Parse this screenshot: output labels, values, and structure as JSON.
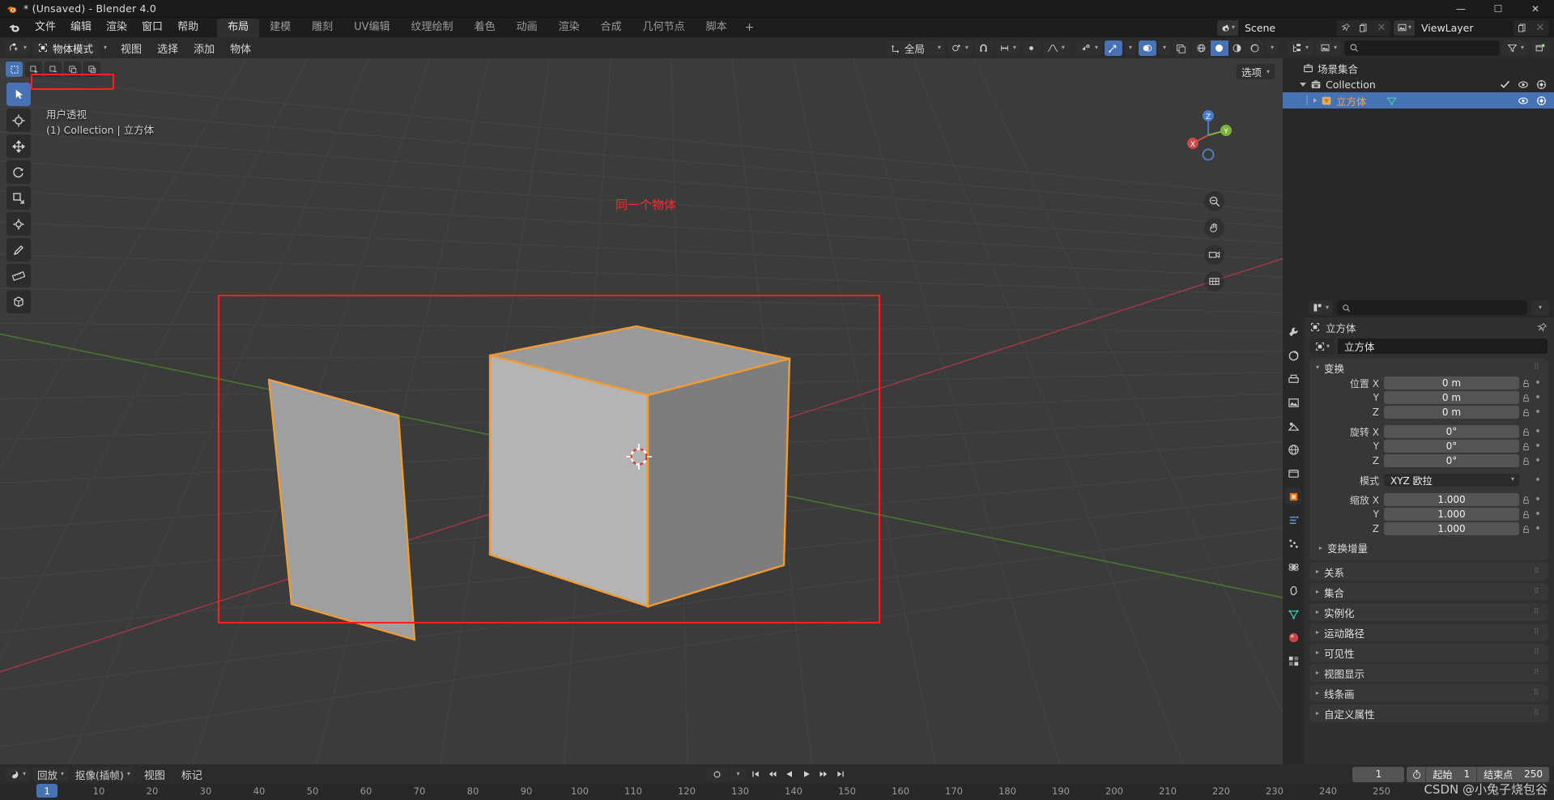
{
  "window": {
    "title": "* (Unsaved) - Blender 4.0",
    "buttons": {
      "minimize": "—",
      "maximize": "☐",
      "close": "✕"
    }
  },
  "topbar": {
    "menus": [
      "文件",
      "编辑",
      "渲染",
      "窗口",
      "帮助"
    ],
    "workspace_tabs": [
      "布局",
      "建模",
      "雕刻",
      "UV编辑",
      "纹理绘制",
      "着色",
      "动画",
      "渲染",
      "合成",
      "几何节点",
      "脚本"
    ],
    "active_workspace": "布局",
    "add_tab": "+",
    "scene_name": "Scene",
    "viewlayer_name": "ViewLayer"
  },
  "viewport": {
    "mode": "物体模式",
    "menus": [
      "视图",
      "选择",
      "添加",
      "物体"
    ],
    "transform_orientation": "全局",
    "options_label": "选项",
    "overlay_line1": "用户透视",
    "overlay_line2": "(1) Collection | 立方体",
    "annotation": "同一个物体",
    "gizmo_axes": {
      "x": "X",
      "y": "Y",
      "z": "Z"
    },
    "highlight_color": "#ff2020",
    "select_color": "#ff8c1a"
  },
  "outliner": {
    "search_placeholder": "",
    "rows": [
      {
        "label": "场景集合",
        "indent": 0,
        "selected": false,
        "has_toggle": false
      },
      {
        "label": "Collection",
        "indent": 1,
        "selected": false,
        "has_toggle": true
      },
      {
        "label": "立方体",
        "indent": 2,
        "selected": true,
        "has_toggle": true
      }
    ]
  },
  "properties": {
    "search_placeholder": "",
    "breadcrumb": "立方体",
    "object_name": "立方体",
    "transform": {
      "title": "变换",
      "location_label": "位置",
      "rotation_label": "旋转",
      "mode_label": "模式",
      "scale_label": "缩放",
      "axes": [
        "X",
        "Y",
        "Z"
      ],
      "location": [
        "0 m",
        "0 m",
        "0 m"
      ],
      "rotation": [
        "0°",
        "0°",
        "0°"
      ],
      "rotation_mode": "XYZ 欧拉",
      "scale": [
        "1.000",
        "1.000",
        "1.000"
      ],
      "delta_transform": "变换增量"
    },
    "panels": [
      "关系",
      "集合",
      "实例化",
      "运动路径",
      "可见性",
      "视图显示",
      "线条画",
      "自定义属性"
    ]
  },
  "timeline": {
    "editor_menus": [
      "回放",
      "抠像(插帧)",
      "视图",
      "标记"
    ],
    "current_frame": "1",
    "start_label": "起始",
    "start_value": "1",
    "end_label": "结束点",
    "end_value": "250",
    "ruler_ticks": [
      "1",
      "10",
      "20",
      "30",
      "40",
      "50",
      "60",
      "70",
      "80",
      "90",
      "100",
      "110",
      "120",
      "130",
      "140",
      "150",
      "160",
      "170",
      "180",
      "190",
      "200",
      "210",
      "220",
      "230",
      "240",
      "250"
    ],
    "playhead_frame": "1"
  },
  "watermark": "CSDN @小兔子烧包谷"
}
